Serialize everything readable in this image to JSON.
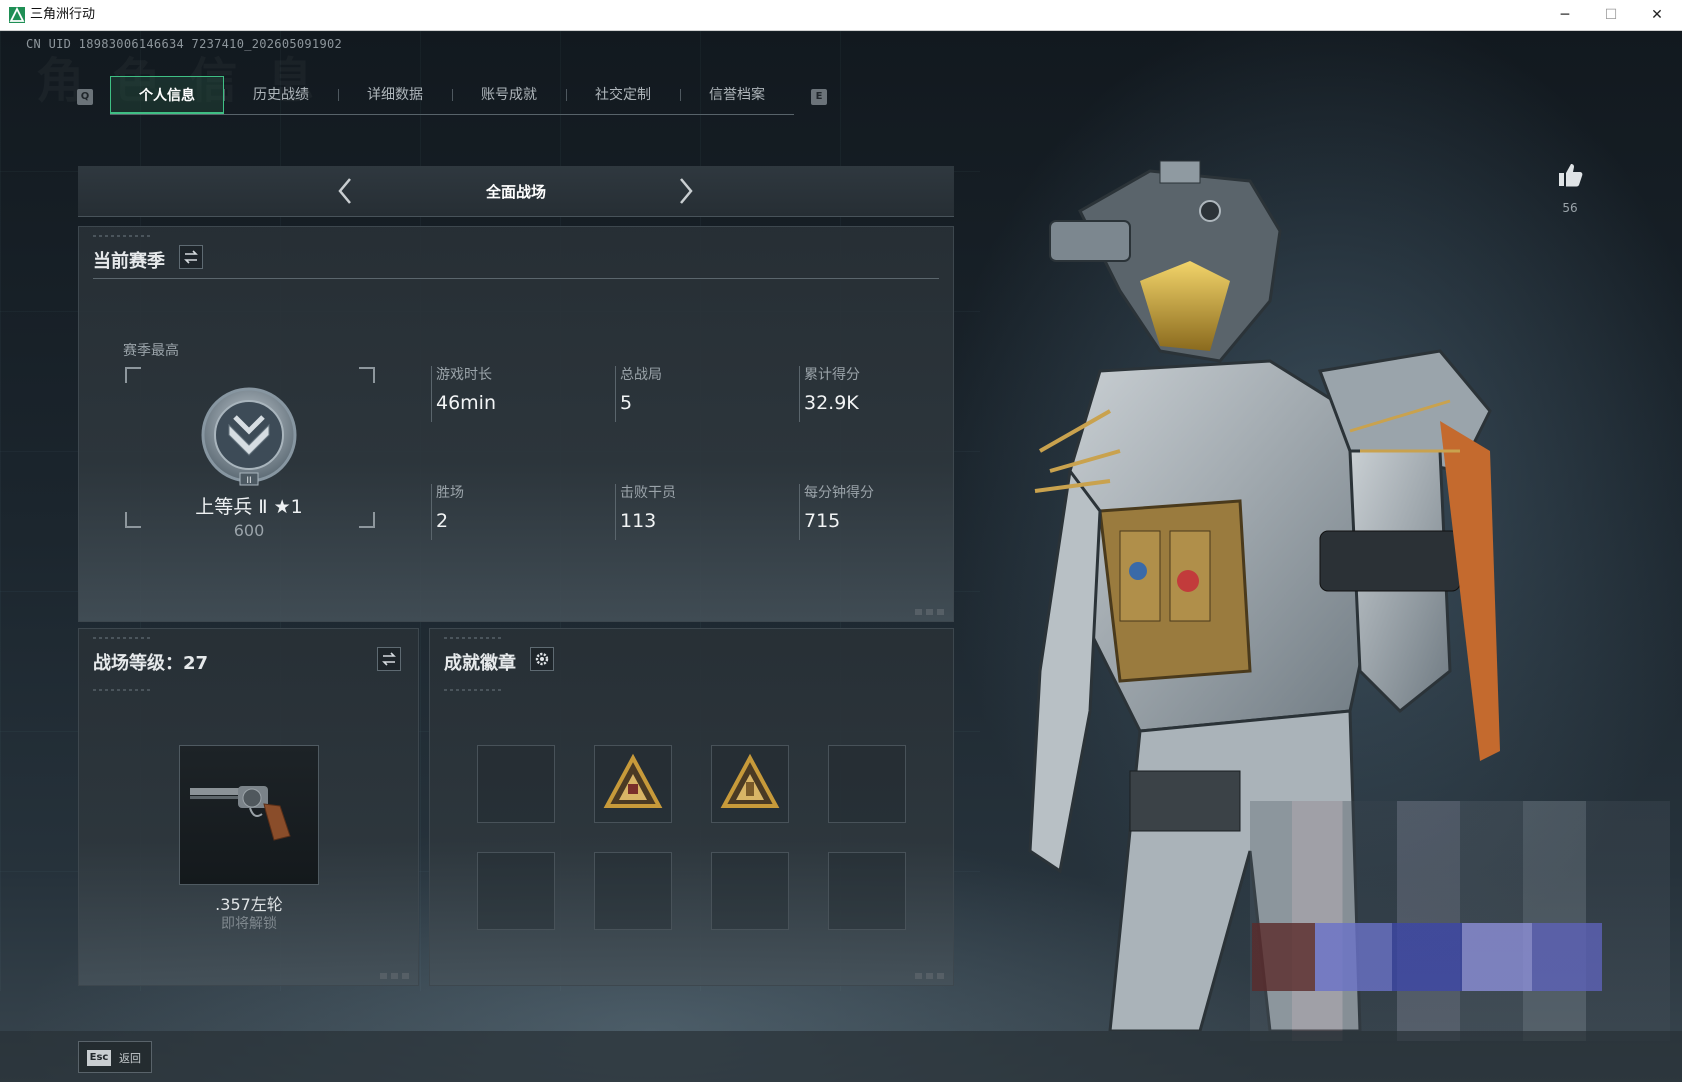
{
  "window": {
    "title": "三角洲行动",
    "minimize": "─",
    "maximize": "☐",
    "close": "✕"
  },
  "uid": "CN UID 18983006146634 7237410_202605091902",
  "tabs": {
    "prev_key": "Q",
    "next_key": "E",
    "items": [
      {
        "label": "个人信息",
        "active": true
      },
      {
        "label": "历史战绩",
        "active": false
      },
      {
        "label": "详细数据",
        "active": false
      },
      {
        "label": "账号成就",
        "active": false
      },
      {
        "label": "社交定制",
        "active": false
      },
      {
        "label": "信誉档案",
        "active": false
      }
    ]
  },
  "mode": {
    "name": "全面战场"
  },
  "season": {
    "title": "当前赛季",
    "best_label": "赛季最高",
    "rank_name": "上等兵 Ⅱ ★1",
    "rank_score": "600",
    "stats": [
      {
        "label": "游戏时长",
        "value": "46min"
      },
      {
        "label": "总战局",
        "value": "5"
      },
      {
        "label": "累计得分",
        "value": "32.9K"
      },
      {
        "label": "胜场",
        "value": "2"
      },
      {
        "label": "击败干员",
        "value": "113"
      },
      {
        "label": "每分钟得分",
        "value": "715"
      }
    ]
  },
  "level": {
    "title": "战场等级：27",
    "weapon_name": ".357左轮",
    "weapon_status": "即将解锁"
  },
  "badges": {
    "title": "成就徽章",
    "slots": [
      false,
      true,
      true,
      false,
      false,
      false,
      false,
      false
    ]
  },
  "likes": {
    "count": "56"
  },
  "footer": {
    "esc_key": "Esc",
    "back_label": "返回"
  },
  "colors": {
    "accent": "#3fbf84",
    "badge_gold": "#c79a3a"
  }
}
